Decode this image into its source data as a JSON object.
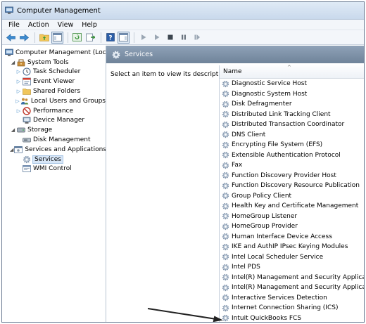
{
  "window": {
    "title": "Computer Management"
  },
  "menu": [
    "File",
    "Action",
    "View",
    "Help"
  ],
  "toolbar": [
    "back-icon",
    "forward-icon",
    "up-folder-icon",
    "properties-icon",
    "refresh-icon",
    "export-icon",
    "help-icon",
    "show-hide-icon",
    "play-icon",
    "play-alt-icon",
    "stop-icon",
    "pause-icon",
    "restart-icon"
  ],
  "tree": [
    {
      "label": "Computer Management (Local)",
      "indent": 0,
      "expander": "",
      "icon": "computer-icon"
    },
    {
      "label": "System Tools",
      "indent": 1,
      "expander": "expanded",
      "icon": "tools-icon"
    },
    {
      "label": "Task Scheduler",
      "indent": 2,
      "expander": "collapsed",
      "icon": "clock-icon"
    },
    {
      "label": "Event Viewer",
      "indent": 2,
      "expander": "collapsed",
      "icon": "event-viewer-icon"
    },
    {
      "label": "Shared Folders",
      "indent": 2,
      "expander": "collapsed",
      "icon": "folder-icon"
    },
    {
      "label": "Local Users and Groups",
      "indent": 2,
      "expander": "collapsed",
      "icon": "users-icon"
    },
    {
      "label": "Performance",
      "indent": 2,
      "expander": "collapsed",
      "icon": "performance-icon"
    },
    {
      "label": "Device Manager",
      "indent": 2,
      "expander": "",
      "icon": "device-manager-icon"
    },
    {
      "label": "Storage",
      "indent": 1,
      "expander": "expanded",
      "icon": "storage-icon"
    },
    {
      "label": "Disk Management",
      "indent": 2,
      "expander": "",
      "icon": "disk-icon"
    },
    {
      "label": "Services and Applications",
      "indent": 1,
      "expander": "expanded",
      "icon": "services-apps-icon"
    },
    {
      "label": "Services",
      "indent": 2,
      "expander": "",
      "icon": "gear-icon",
      "selected": true
    },
    {
      "label": "WMI Control",
      "indent": 2,
      "expander": "",
      "icon": "wmi-icon"
    }
  ],
  "panel": {
    "title": "Services",
    "description": "Select an item to view its description.",
    "column_header": "Name"
  },
  "services": [
    "Diagnostic Service Host",
    "Diagnostic System Host",
    "Disk Defragmenter",
    "Distributed Link Tracking Client",
    "Distributed Transaction Coordinator",
    "DNS Client",
    "Encrypting File System (EFS)",
    "Extensible Authentication Protocol",
    "Fax",
    "Function Discovery Provider Host",
    "Function Discovery Resource Publication",
    "Group Policy Client",
    "Health Key and Certificate Management",
    "HomeGroup Listener",
    "HomeGroup Provider",
    "Human Interface Device Access",
    "IKE and AuthIP IPsec Keying Modules",
    "Intel Local Scheduler Service",
    "Intel PDS",
    "Intel(R) Management and Security Applicat...",
    "Intel(R) Management and Security Applicat...",
    "Interactive Services Detection",
    "Internet Connection Sharing (ICS)",
    "Intuit QuickBooks FCS"
  ],
  "colors": {
    "header_band": "#7a8ea4",
    "selection": "#d7e6f7",
    "arrow": "#222222"
  }
}
